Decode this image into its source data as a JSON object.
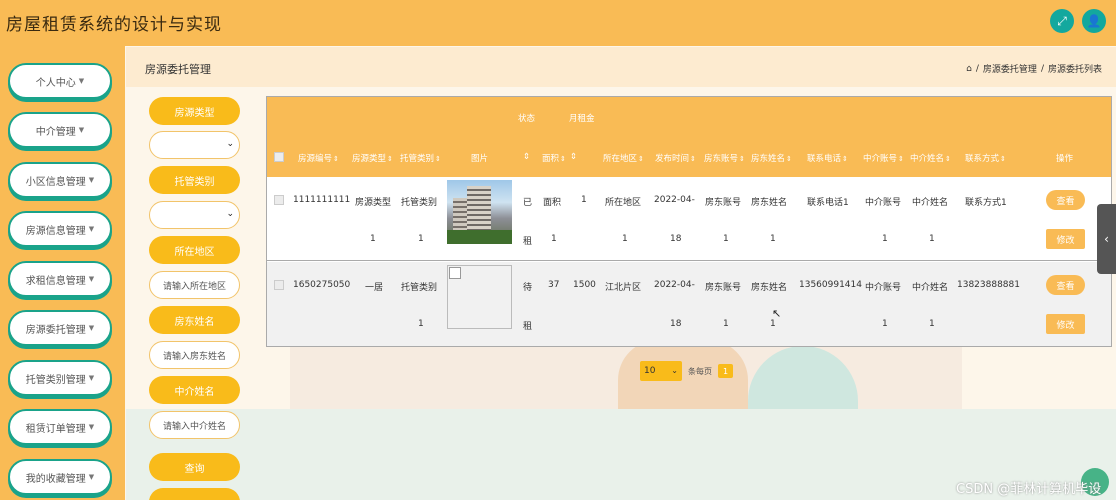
{
  "header": {
    "title": "房屋租赁系统的设计与实现",
    "buttons": [
      "expand-icon",
      "user-icon"
    ]
  },
  "sidebar": {
    "items": [
      {
        "label": "个人中心"
      },
      {
        "label": "中介管理"
      },
      {
        "label": "小区信息管理"
      },
      {
        "label": "房源信息管理"
      },
      {
        "label": "求租信息管理"
      },
      {
        "label": "房源委托管理"
      },
      {
        "label": "托管类别管理"
      },
      {
        "label": "租赁订单管理"
      },
      {
        "label": "我的收藏管理"
      }
    ]
  },
  "breadcrumb": {
    "page_title": "房源委托管理",
    "sep": "/",
    "items": [
      "房源委托管理",
      "房源委托列表"
    ]
  },
  "search": {
    "fields": [
      {
        "label": "房源类型",
        "type": "select",
        "value": ""
      },
      {
        "label": "托管类别",
        "type": "select",
        "value": ""
      },
      {
        "label": "所在地区",
        "type": "input",
        "placeholder": "请输入所在地区"
      },
      {
        "label": "房东姓名",
        "type": "input",
        "placeholder": "请输入房东姓名"
      },
      {
        "label": "中介姓名",
        "type": "input",
        "placeholder": "请输入中介姓名"
      }
    ],
    "submit_label": "查询"
  },
  "table": {
    "header_top": {
      "status": "状态",
      "rent": "月租金"
    },
    "columns": [
      "房源编号",
      "房源类型",
      "托管类别",
      "图片",
      "",
      "面积",
      "",
      "所在地区",
      "发布时间",
      "房东账号",
      "房东姓名",
      "联系电话",
      "中介账号",
      "中介姓名",
      "联系方式",
      "操作"
    ],
    "rows": [
      {
        "line1": [
          "1111111111",
          "房源类型",
          "托管类别",
          "已",
          "面积",
          "1",
          "所在地区",
          "2022-04-",
          "房东账号",
          "房东姓名",
          "联系电话1",
          "中介账号",
          "中介姓名",
          "联系方式1"
        ],
        "line2": [
          "1",
          "1",
          "租",
          "1",
          "1",
          "18",
          "1",
          "1",
          "1",
          "1"
        ]
      },
      {
        "line1": [
          "1650275050",
          "一居",
          "托管类别",
          "待",
          "37",
          "1500",
          "江北片区",
          "2022-04-",
          "房东账号",
          "房东姓名",
          "13560991414",
          "中介账号",
          "中介姓名",
          "13823888881"
        ],
        "line2": [
          "1",
          "租",
          "18",
          "1",
          "1",
          "1",
          "1"
        ]
      }
    ],
    "view_label": "查看",
    "edit_label": "修改"
  },
  "pagination": {
    "page_size": "10",
    "per_page_text": "条每页",
    "current_page": "1"
  },
  "watermark": "CSDN @菲林计算机毕设",
  "colors": {
    "primary": "#f9bb55",
    "accent": "#f9bb1a",
    "nav_border": "#1aa38a",
    "header_btn": "#13a89e"
  }
}
